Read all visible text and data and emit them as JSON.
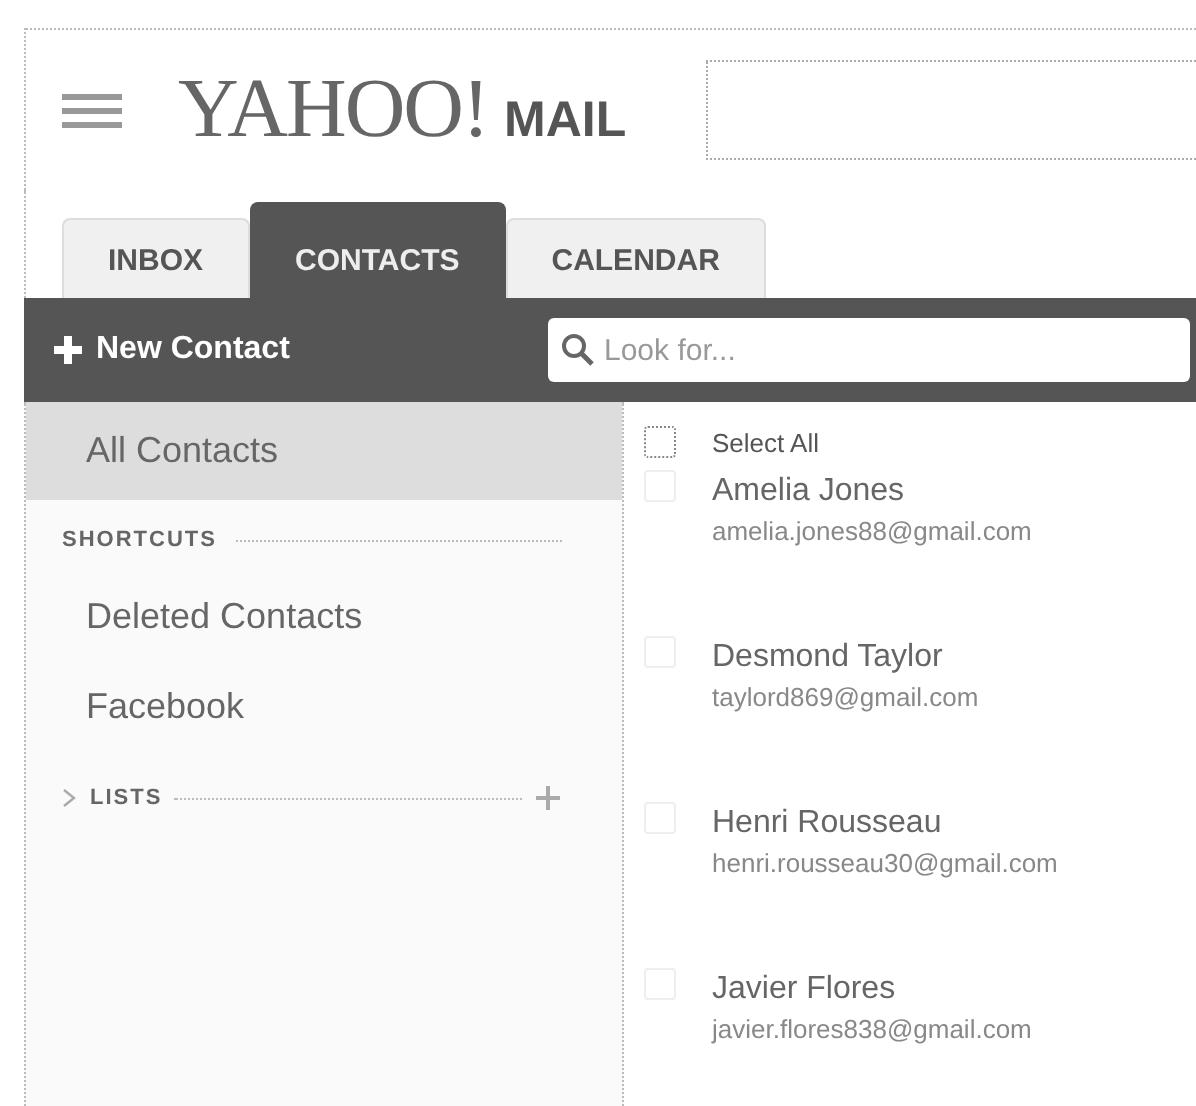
{
  "header": {
    "logo": "YAHOO!",
    "logo_suffix": "MAIL"
  },
  "tabs": [
    {
      "label": "INBOX",
      "selected": false
    },
    {
      "label": "CONTACTS",
      "selected": true
    },
    {
      "label": "CALENDAR",
      "selected": false
    }
  ],
  "toolbar": {
    "new_button": "New Contact",
    "search": {
      "placeholder": "Look for..."
    }
  },
  "sidebar": {
    "items": [
      {
        "label": "All Contacts",
        "selected": true
      }
    ],
    "shortcuts_heading": "SHORTCUTS",
    "shortcuts": [
      {
        "label": "Deleted Contacts",
        "selected": false
      },
      {
        "label": "Facebook",
        "selected": false
      }
    ],
    "lists_heading": "LISTS",
    "lists_expanded": false
  },
  "contacts": {
    "select_all": {
      "label": "Select All",
      "checked": false
    },
    "items": [
      {
        "name": "Amelia Jones",
        "email": "amelia.jones88@gmail.com",
        "checked": false
      },
      {
        "name": "Desmond Taylor",
        "email": "taylord869@gmail.com",
        "checked": false
      },
      {
        "name": "Henri Rousseau",
        "email": "henri.rousseau30@gmail.com",
        "checked": false
      },
      {
        "name": "Javier Flores",
        "email": "javier.flores838@gmail.com",
        "checked": false
      }
    ]
  }
}
